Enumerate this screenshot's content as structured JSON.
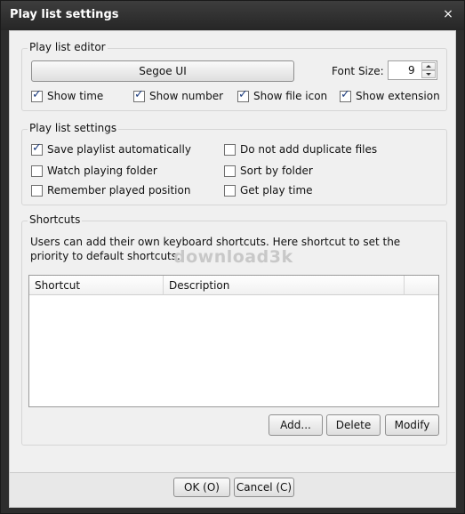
{
  "window": {
    "title": "Play list settings",
    "close_glyph": "×"
  },
  "editor": {
    "legend": "Play list editor",
    "font_button": "Segoe UI",
    "font_size_label": "Font Size:",
    "font_size_value": "9",
    "checks": [
      {
        "label": "Show time",
        "checked": true
      },
      {
        "label": "Show number",
        "checked": true
      },
      {
        "label": "Show file icon",
        "checked": true
      },
      {
        "label": "Show extension",
        "checked": true
      }
    ]
  },
  "settings": {
    "legend": "Play list settings",
    "checks": [
      {
        "label": "Save playlist automatically",
        "checked": true
      },
      {
        "label": "Watch playing folder",
        "checked": false
      },
      {
        "label": "Remember played position",
        "checked": false
      },
      {
        "label": "Do not add duplicate files",
        "checked": false
      },
      {
        "label": "Sort by folder",
        "checked": false
      },
      {
        "label": "Get play time",
        "checked": false
      }
    ]
  },
  "shortcuts": {
    "legend": "Shortcuts",
    "description": "Users can add their own keyboard shortcuts. Here shortcut to set the priority to default shortcuts.",
    "columns": [
      "Shortcut",
      "Description"
    ],
    "rows": [],
    "add_label": "Add...",
    "delete_label": "Delete",
    "modify_label": "Modify"
  },
  "watermark": "download3k",
  "footer": {
    "ok_label": "OK (O)",
    "cancel_label": "Cancel (C)"
  },
  "icons": {
    "checkmark": "checkmark-icon",
    "spin_up": "spin-up-icon",
    "spin_down": "spin-down-icon",
    "close": "close-icon"
  }
}
